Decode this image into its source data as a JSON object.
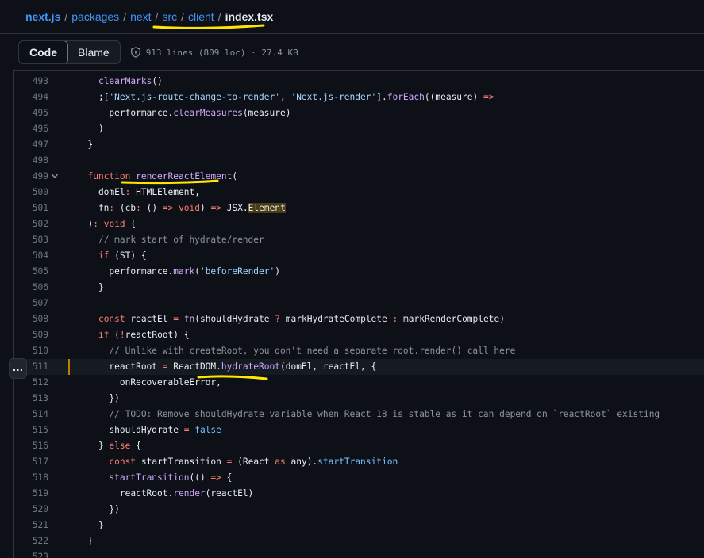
{
  "breadcrumb": {
    "items": [
      "next.js",
      "packages",
      "next",
      "src",
      "client"
    ],
    "current": "index.tsx",
    "separator": "/"
  },
  "toolbar": {
    "code_label": "Code",
    "blame_label": "Blame",
    "file_info": "913 lines (809 loc) · 27.4 KB"
  },
  "colors": {
    "background": "#0d1117",
    "link": "#4493f8",
    "keyword": "#ff7b72",
    "function": "#d2a8ff",
    "string": "#a5d6ff",
    "comment": "#8b949e",
    "annotation": "#ffe500"
  },
  "active_line": "511",
  "code_lines": [
    {
      "n": "493",
      "tokens": [
        [
          "t-id",
          "    "
        ],
        [
          "t-fn",
          "clearMarks"
        ],
        [
          "t-id",
          "()"
        ]
      ]
    },
    {
      "n": "494",
      "tokens": [
        [
          "t-id",
          "    ;["
        ],
        [
          "t-str",
          "'Next.js-route-change-to-render'"
        ],
        [
          "t-id",
          ", "
        ],
        [
          "t-str",
          "'Next.js-render'"
        ],
        [
          "t-id",
          "]."
        ],
        [
          "t-fn",
          "forEach"
        ],
        [
          "t-id",
          "((measure) "
        ],
        [
          "t-kw",
          "=>"
        ]
      ]
    },
    {
      "n": "495",
      "tokens": [
        [
          "t-id",
          "      performance."
        ],
        [
          "t-fn",
          "clearMeasures"
        ],
        [
          "t-id",
          "(measure)"
        ]
      ]
    },
    {
      "n": "496",
      "tokens": [
        [
          "t-id",
          "    )"
        ]
      ]
    },
    {
      "n": "497",
      "tokens": [
        [
          "t-id",
          "  }"
        ]
      ]
    },
    {
      "n": "498",
      "tokens": []
    },
    {
      "n": "499",
      "fold": true,
      "tokens": [
        [
          "t-id",
          "  "
        ],
        [
          "t-kw",
          "function "
        ],
        [
          "t-fn",
          "renderReactElement"
        ],
        [
          "t-id",
          "("
        ]
      ]
    },
    {
      "n": "500",
      "tokens": [
        [
          "t-id",
          "    domEl"
        ],
        [
          "t-kw",
          ":"
        ],
        [
          "t-id",
          " HTMLElement,"
        ]
      ]
    },
    {
      "n": "501",
      "tokens": [
        [
          "t-id",
          "    fn"
        ],
        [
          "t-kw",
          ":"
        ],
        [
          "t-id",
          " (cb"
        ],
        [
          "t-kw",
          ":"
        ],
        [
          "t-id",
          " () "
        ],
        [
          "t-kw",
          "=>"
        ],
        [
          "t-id",
          " "
        ],
        [
          "t-kw",
          "void"
        ],
        [
          "t-id",
          ") "
        ],
        [
          "t-kw",
          "=>"
        ],
        [
          "t-id",
          " JSX."
        ],
        [
          "hl-box",
          "Element"
        ]
      ]
    },
    {
      "n": "502",
      "tokens": [
        [
          "t-id",
          "  )"
        ],
        [
          "t-kw",
          ":"
        ],
        [
          "t-id",
          " "
        ],
        [
          "t-kw",
          "void"
        ],
        [
          "t-id",
          " {"
        ]
      ]
    },
    {
      "n": "503",
      "tokens": [
        [
          "t-cm",
          "    // mark start of hydrate/render"
        ]
      ]
    },
    {
      "n": "504",
      "tokens": [
        [
          "t-id",
          "    "
        ],
        [
          "t-kw",
          "if"
        ],
        [
          "t-id",
          " (ST) {"
        ]
      ]
    },
    {
      "n": "505",
      "tokens": [
        [
          "t-id",
          "      performance."
        ],
        [
          "t-fn",
          "mark"
        ],
        [
          "t-id",
          "("
        ],
        [
          "t-str",
          "'beforeRender'"
        ],
        [
          "t-id",
          ")"
        ]
      ]
    },
    {
      "n": "506",
      "tokens": [
        [
          "t-id",
          "    }"
        ]
      ]
    },
    {
      "n": "507",
      "tokens": []
    },
    {
      "n": "508",
      "tokens": [
        [
          "t-id",
          "    "
        ],
        [
          "t-kw",
          "const"
        ],
        [
          "t-id",
          " reactEl "
        ],
        [
          "t-kw",
          "="
        ],
        [
          "t-id",
          " "
        ],
        [
          "t-fn",
          "fn"
        ],
        [
          "t-id",
          "(shouldHydrate "
        ],
        [
          "t-kw",
          "?"
        ],
        [
          "t-id",
          " markHydrateComplete "
        ],
        [
          "t-kw",
          ":"
        ],
        [
          "t-id",
          " markRenderComplete)"
        ]
      ]
    },
    {
      "n": "509",
      "tokens": [
        [
          "t-id",
          "    "
        ],
        [
          "t-kw",
          "if"
        ],
        [
          "t-id",
          " ("
        ],
        [
          "t-kw",
          "!"
        ],
        [
          "t-id",
          "reactRoot) {"
        ]
      ]
    },
    {
      "n": "510",
      "tokens": [
        [
          "t-cm",
          "      // Unlike with createRoot, you don't need a separate root.render() call here"
        ]
      ]
    },
    {
      "n": "511",
      "tokens": [
        [
          "t-id",
          "      reactRoot "
        ],
        [
          "t-kw",
          "="
        ],
        [
          "t-id",
          " ReactDOM."
        ],
        [
          "t-fn",
          "hydrateRoot"
        ],
        [
          "t-id",
          "(domEl, reactEl, {"
        ]
      ]
    },
    {
      "n": "512",
      "tokens": [
        [
          "t-id",
          "        onRecoverableError,"
        ]
      ]
    },
    {
      "n": "513",
      "tokens": [
        [
          "t-id",
          "      })"
        ]
      ]
    },
    {
      "n": "514",
      "tokens": [
        [
          "t-cm",
          "      // TODO: Remove shouldHydrate variable when React 18 is stable as it can depend on `reactRoot` existing"
        ]
      ]
    },
    {
      "n": "515",
      "tokens": [
        [
          "t-id",
          "      shouldHydrate "
        ],
        [
          "t-kw",
          "="
        ],
        [
          "t-id",
          " "
        ],
        [
          "t-const",
          "false"
        ]
      ]
    },
    {
      "n": "516",
      "tokens": [
        [
          "t-id",
          "    } "
        ],
        [
          "t-kw",
          "else"
        ],
        [
          "t-id",
          " {"
        ]
      ]
    },
    {
      "n": "517",
      "tokens": [
        [
          "t-id",
          "      "
        ],
        [
          "t-kw",
          "const"
        ],
        [
          "t-id",
          " startTransition "
        ],
        [
          "t-kw",
          "="
        ],
        [
          "t-id",
          " (React "
        ],
        [
          "t-kw",
          "as"
        ],
        [
          "t-id",
          " any)."
        ],
        [
          "t-const",
          "startTransition"
        ]
      ]
    },
    {
      "n": "518",
      "tokens": [
        [
          "t-id",
          "      "
        ],
        [
          "t-fn",
          "startTransition"
        ],
        [
          "t-id",
          "(() "
        ],
        [
          "t-kw",
          "=>"
        ],
        [
          "t-id",
          " {"
        ]
      ]
    },
    {
      "n": "519",
      "tokens": [
        [
          "t-id",
          "        reactRoot."
        ],
        [
          "t-fn",
          "render"
        ],
        [
          "t-id",
          "(reactEl)"
        ]
      ]
    },
    {
      "n": "520",
      "tokens": [
        [
          "t-id",
          "      })"
        ]
      ]
    },
    {
      "n": "521",
      "tokens": [
        [
          "t-id",
          "    }"
        ]
      ]
    },
    {
      "n": "522",
      "tokens": [
        [
          "t-id",
          "  }"
        ]
      ]
    },
    {
      "n": "523",
      "tokens": []
    }
  ],
  "more_button": "…"
}
